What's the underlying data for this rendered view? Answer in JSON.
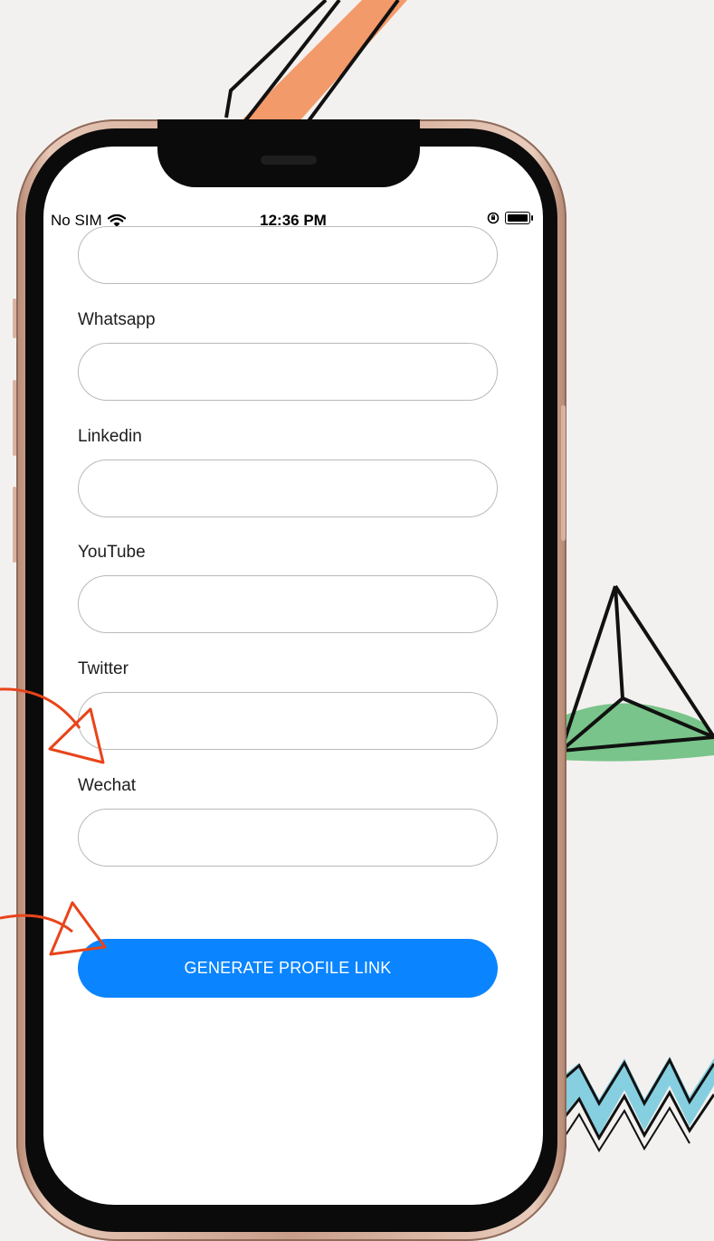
{
  "status_bar": {
    "carrier": "No SIM",
    "time": "12:36 PM"
  },
  "form": {
    "fields": [
      {
        "label": "",
        "value": ""
      },
      {
        "label": "Whatsapp",
        "value": ""
      },
      {
        "label": "Linkedin",
        "value": ""
      },
      {
        "label": "YouTube",
        "value": ""
      },
      {
        "label": "Twitter",
        "value": ""
      },
      {
        "label": "Wechat",
        "value": ""
      }
    ],
    "submit_label": "GENERATE PROFILE LINK"
  },
  "colors": {
    "primary_button": "#0a84ff",
    "background": "#f3f1ef",
    "arrow_accent": "#e8441a"
  },
  "icons": {
    "wifi": "wifi-icon",
    "orientation_lock": "orientation-lock-icon",
    "battery": "battery-icon"
  }
}
